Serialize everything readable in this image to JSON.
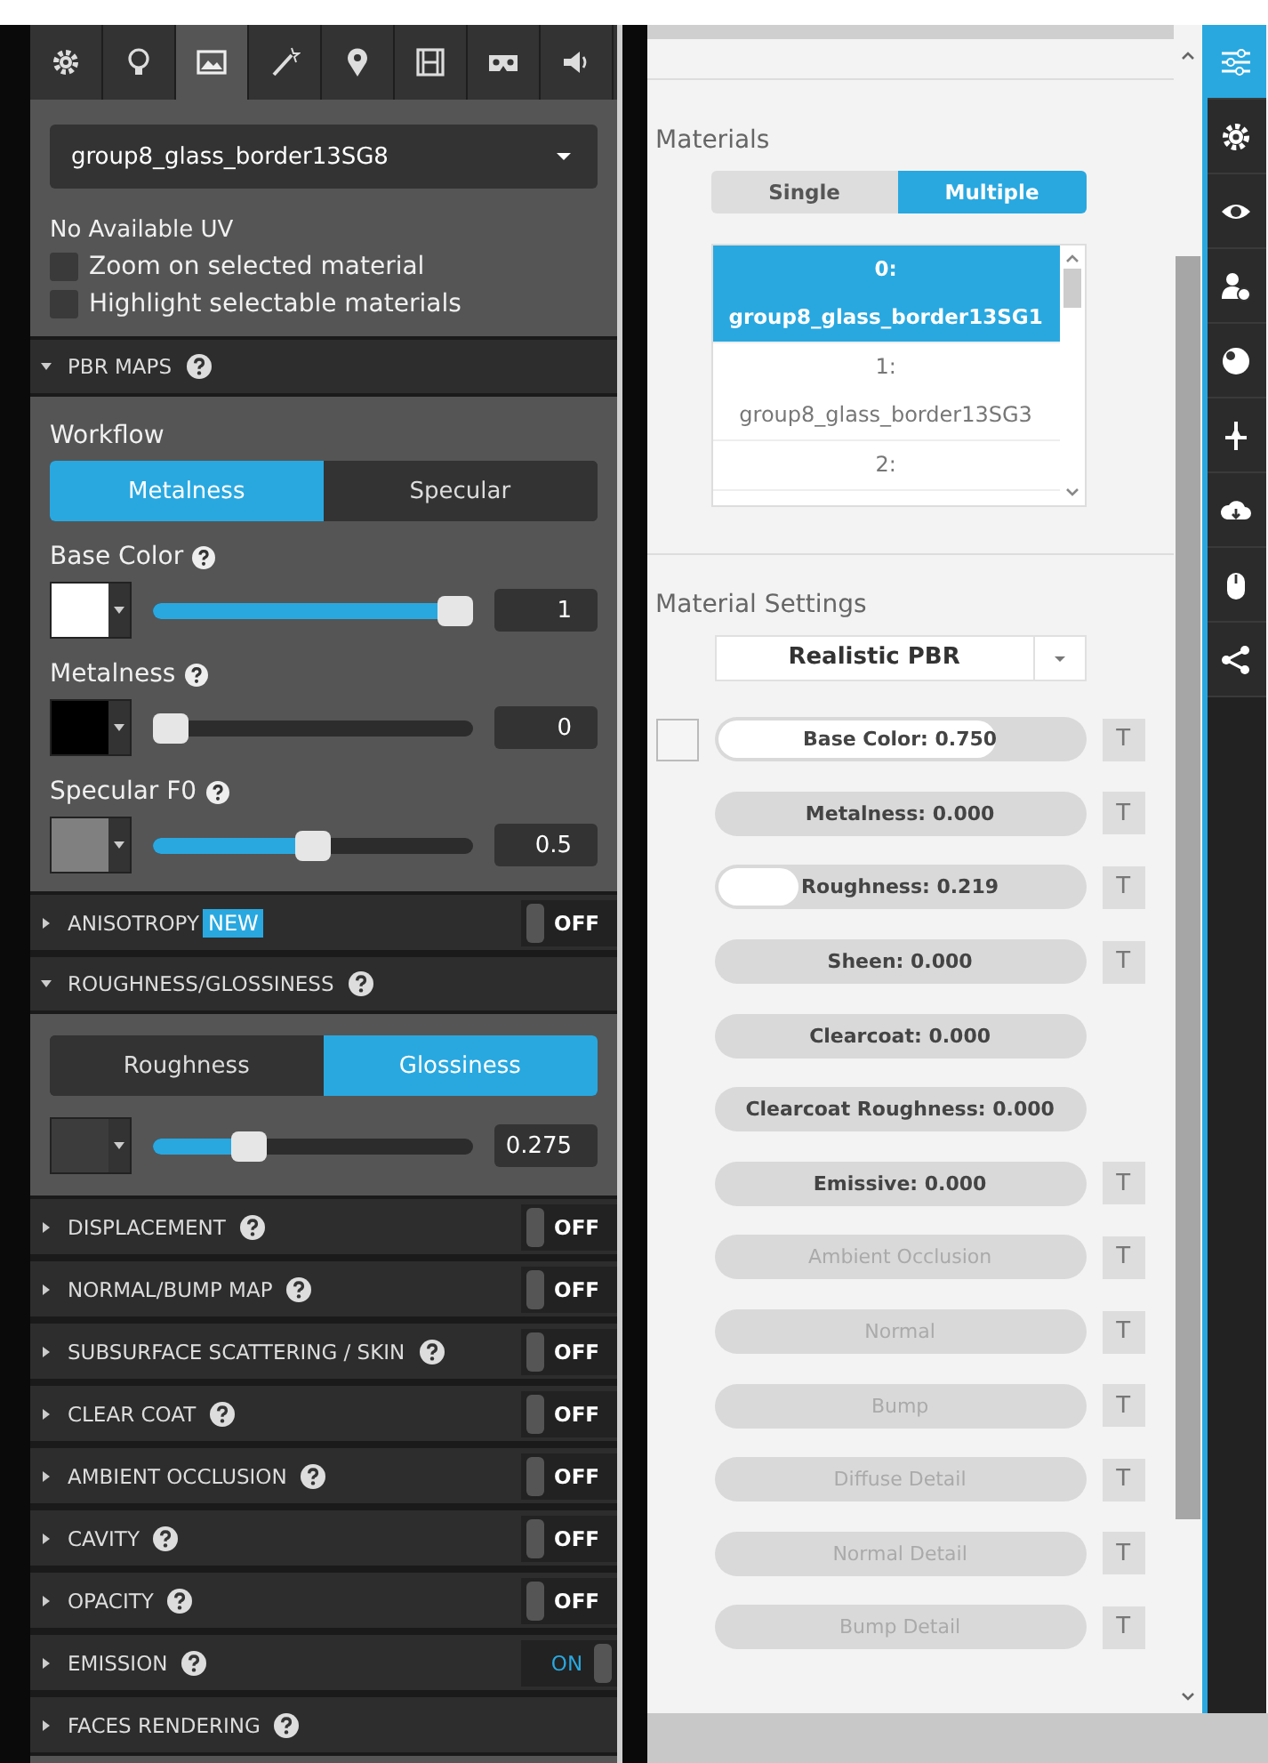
{
  "left_panel": {
    "tabs": [
      {
        "selected": false
      },
      {
        "selected": false
      },
      {
        "selected": true
      },
      {
        "selected": false
      },
      {
        "selected": false
      },
      {
        "selected": false
      },
      {
        "selected": false
      },
      {
        "selected": false
      }
    ],
    "material_select": {
      "value": "group8_glass_border13SG8"
    },
    "uv_note": "No Available UV",
    "checkboxes": [
      {
        "label": "Zoom on selected material",
        "checked": false
      },
      {
        "label": "Highlight selectable materials",
        "checked": false
      }
    ],
    "pbr_maps": {
      "title": "PBR MAPS",
      "expanded": true,
      "help": true,
      "workflow_label": "Workflow",
      "workflow": [
        {
          "label": "Metalness",
          "selected": true
        },
        {
          "label": "Specular",
          "selected": false
        }
      ],
      "channels": [
        {
          "label": "Base Color",
          "help": true,
          "color": "#ffffff",
          "level": 1,
          "value": "1"
        },
        {
          "label": "Metalness",
          "help": true,
          "color": "#000000",
          "level": 0,
          "value": "0"
        },
        {
          "label": "Specular F0",
          "help": true,
          "color": "#808080",
          "level": 0.5,
          "value": "0.5"
        }
      ]
    },
    "anisotropy": {
      "title": "ANISOTROPY",
      "expanded": false,
      "badge": "NEW",
      "toggle": {
        "on": false,
        "label": "OFF"
      }
    },
    "roughness_glossiness": {
      "title": "ROUGHNESS/GLOSSINESS",
      "expanded": true,
      "help": true,
      "modes": [
        {
          "label": "Roughness",
          "selected": false
        },
        {
          "label": "Glossiness",
          "selected": true
        }
      ],
      "channel": {
        "color": "#3c3c3c",
        "level": 0.275,
        "value": "0.275"
      }
    },
    "sections": [
      {
        "title": "DISPLACEMENT",
        "expanded": false,
        "help": true,
        "toggle": {
          "on": false,
          "label": "OFF"
        }
      },
      {
        "title": "NORMAL/BUMP MAP",
        "expanded": false,
        "help": true,
        "toggle": {
          "on": false,
          "label": "OFF"
        }
      },
      {
        "title": "SUBSURFACE SCATTERING / SKIN",
        "expanded": false,
        "help": true,
        "toggle": {
          "on": false,
          "label": "OFF"
        }
      },
      {
        "title": "CLEAR COAT",
        "expanded": false,
        "help": true,
        "toggle": {
          "on": false,
          "label": "OFF"
        }
      },
      {
        "title": "AMBIENT OCCLUSION",
        "expanded": false,
        "help": true,
        "toggle": {
          "on": false,
          "label": "OFF"
        }
      },
      {
        "title": "CAVITY",
        "expanded": false,
        "help": true,
        "toggle": {
          "on": false,
          "label": "OFF"
        }
      },
      {
        "title": "OPACITY",
        "expanded": false,
        "help": true,
        "toggle": {
          "on": false,
          "label": "OFF"
        }
      },
      {
        "title": "EMISSION",
        "expanded": false,
        "help": true,
        "toggle": {
          "on": true,
          "label": "ON"
        }
      },
      {
        "title": "FACES RENDERING",
        "expanded": false,
        "help": true
      }
    ]
  },
  "right_panel": {
    "materials": {
      "title": "Materials",
      "modes": [
        {
          "label": "Single",
          "selected": false
        },
        {
          "label": "Multiple",
          "selected": true
        }
      ],
      "list": [
        {
          "index": "0:",
          "name": "group8_glass_border13SG1",
          "selected": true
        },
        {
          "index": "1:",
          "name": "group8_glass_border13SG3",
          "selected": false
        },
        {
          "index": "2:",
          "selected": false
        }
      ]
    },
    "material_settings": {
      "title": "Material Settings",
      "shader": "Realistic PBR",
      "rows": [
        {
          "label": "Base Color: 0.750",
          "level": 0.75,
          "disabled": false,
          "swatch": true,
          "texture_button": "T"
        },
        {
          "label": "Metalness: 0.000",
          "disabled": false,
          "texture_button": "T"
        },
        {
          "label": "Roughness: 0.219",
          "level": 0.219,
          "disabled": false,
          "texture_button": "T"
        },
        {
          "label": "Sheen: 0.000",
          "disabled": false,
          "texture_button": "T"
        },
        {
          "label": "Clearcoat: 0.000",
          "disabled": false
        },
        {
          "label": "Clearcoat Roughness: 0.000",
          "disabled": false
        },
        {
          "label": "Emissive: 0.000",
          "disabled": false,
          "texture_button": "T"
        },
        {
          "label": "Ambient Occlusion",
          "disabled": true,
          "texture_button": "T"
        },
        {
          "label": "Normal",
          "disabled": true,
          "texture_button": "T"
        },
        {
          "label": "Bump",
          "disabled": true,
          "texture_button": "T"
        },
        {
          "label": "Diffuse Detail",
          "disabled": true,
          "texture_button": "T"
        },
        {
          "label": "Normal Detail",
          "disabled": true,
          "texture_button": "T"
        },
        {
          "label": "Bump Detail",
          "disabled": true,
          "texture_button": "T"
        }
      ]
    }
  },
  "sidebar": {
    "items": [
      {
        "selected": true
      },
      {
        "selected": false
      },
      {
        "selected": false
      },
      {
        "selected": false
      },
      {
        "selected": false
      },
      {
        "selected": false
      },
      {
        "selected": false
      },
      {
        "selected": false
      },
      {
        "selected": false
      }
    ]
  }
}
